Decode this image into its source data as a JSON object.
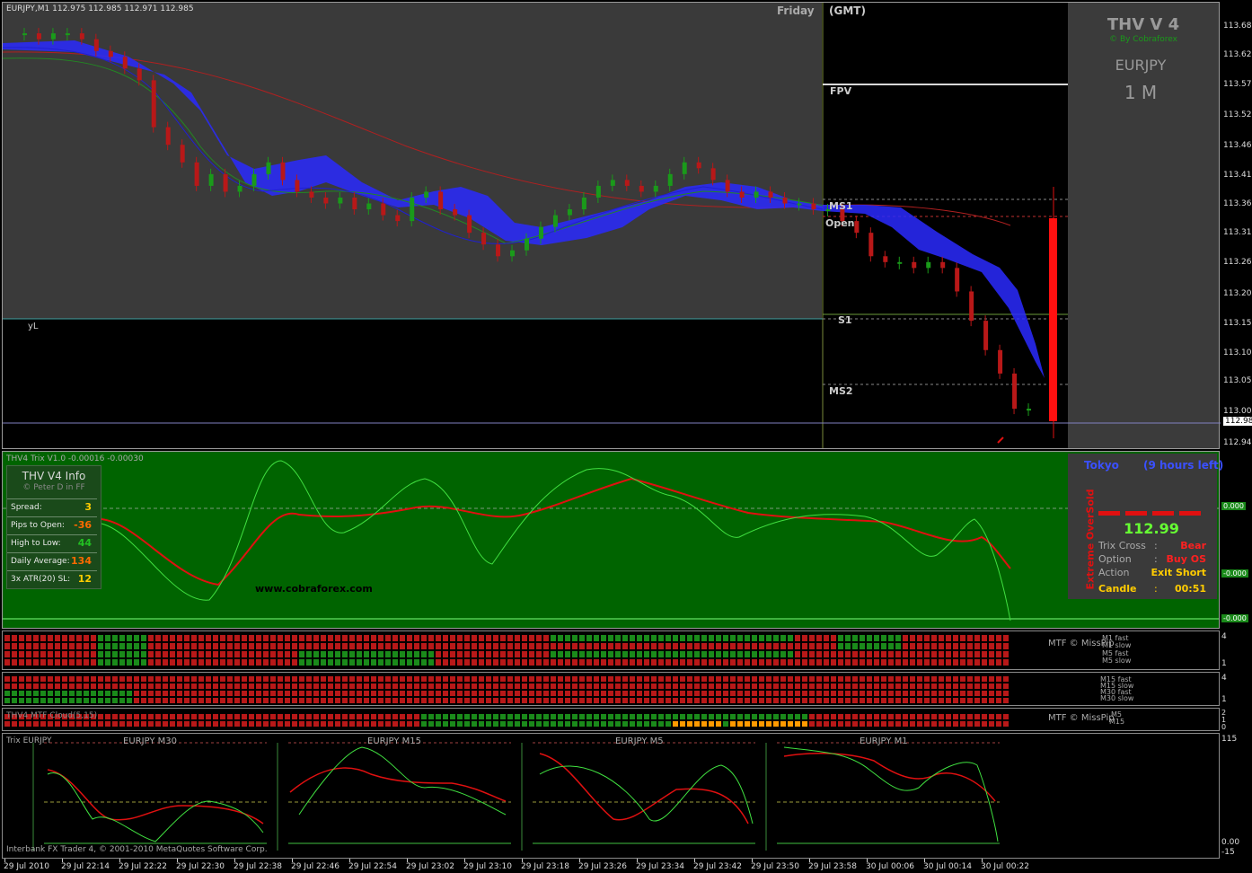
{
  "header": {
    "symbol_line": "EURJPY,M1  112.975 112.985 112.971 112.985",
    "day": "Friday",
    "tz": "(GMT)"
  },
  "levels": {
    "fpv": "FPV",
    "ms1": "MS1",
    "open": "Open",
    "s1": "S1",
    "ms2": "MS2",
    "yl": "yL"
  },
  "brand": {
    "title": "THV V 4",
    "by": "© By Cobraforex",
    "pair": "EURJPY",
    "tf": "1 M"
  },
  "price_axis": [
    "113.680",
    "113.625",
    "113.575",
    "113.520",
    "113.465",
    "113.415",
    "113.365",
    "113.310",
    "113.260",
    "113.205",
    "113.155",
    "113.105",
    "113.050",
    "113.000",
    "112.985",
    "112.945"
  ],
  "trix_axis": [
    "0.000",
    "-0.000",
    "-0.000"
  ],
  "trix_header": "THV4 Trix V1.0 -0.00016 -0.00030",
  "info_panel": {
    "title": "THV  V4  Info",
    "by": "© Peter D in FF",
    "rows": [
      {
        "k": "Spread:",
        "v": "3",
        "color": "#ffcc00"
      },
      {
        "k": "Pips to Open:",
        "v": "-36",
        "color": "#ff6a00"
      },
      {
        "k": "High to Low:",
        "v": "44",
        "color": "#22c022"
      },
      {
        "k": "Daily Average:",
        "v": "134",
        "color": "#ff6a00"
      },
      {
        "k": "3x ATR(20) SL:",
        "v": "12",
        "color": "#ffcc00"
      }
    ]
  },
  "watermark": "www.cobraforex.com",
  "signal_panel": {
    "session": "Tokyo",
    "left": "(9 hours left)",
    "vertical": "Extreme OverSold",
    "price": "112.99",
    "rows": [
      {
        "k": "Trix Cross",
        "sep": ":",
        "v": "Bear"
      },
      {
        "k": "Option",
        "sep": ":",
        "v": "Buy OS"
      },
      {
        "k": "Action",
        "sep": ":",
        "v": "Exit Short"
      },
      {
        "k": "Candle",
        "sep": ":",
        "v": "00:51"
      }
    ]
  },
  "mtf1": {
    "label": "MTF © MissPip",
    "lines": [
      "M1 fast",
      "M1 slow",
      "M5 fast",
      "M5 slow"
    ],
    "axis": [
      "4",
      "1"
    ]
  },
  "mtf2": {
    "lines": [
      "M15 fast",
      "M15 slow",
      "M30 fast",
      "M30 slow"
    ],
    "axis": [
      "4",
      "1"
    ]
  },
  "mtf3": {
    "title": "THV4 MTF Cloud(5,15)",
    "label": "MTF © MissPip",
    "lines": [
      "M5",
      "M15"
    ],
    "axis": [
      "2",
      "1",
      "0"
    ]
  },
  "bottom": {
    "title": "Trix EURJPY",
    "charts": [
      "EURJPY  M30",
      "EURJPY  M15",
      "EURJPY  M5",
      "EURJPY  M1"
    ],
    "axis": [
      "115",
      "0.00",
      "-15"
    ],
    "copyright": "Interbank FX Trader 4, © 2001-2010 MetaQuotes Software Corp."
  },
  "time_axis": [
    "29 Jul 2010",
    "29 Jul 22:14",
    "29 Jul 22:22",
    "29 Jul 22:30",
    "29 Jul 22:38",
    "29 Jul 22:46",
    "29 Jul 22:54",
    "29 Jul 23:02",
    "29 Jul 23:10",
    "29 Jul 23:18",
    "29 Jul 23:26",
    "29 Jul 23:34",
    "29 Jul 23:42",
    "29 Jul 23:50",
    "29 Jul 23:58",
    "30 Jul 00:06",
    "30 Jul 00:14",
    "30 Jul 00:22"
  ],
  "chart_data": {
    "type": "candlestick",
    "symbol": "EURJPY",
    "timeframe": "M1",
    "ylim": [
      112.945,
      113.68
    ],
    "last_price": 112.985,
    "close_series": [
      113.64,
      113.64,
      113.63,
      113.64,
      113.64,
      113.63,
      113.61,
      113.6,
      113.58,
      113.56,
      113.48,
      113.45,
      113.42,
      113.38,
      113.4,
      113.37,
      113.38,
      113.4,
      113.42,
      113.39,
      113.37,
      113.36,
      113.35,
      113.36,
      113.34,
      113.35,
      113.33,
      113.32,
      113.36,
      113.37,
      113.34,
      113.33,
      113.3,
      113.28,
      113.26,
      113.27,
      113.29,
      113.31,
      113.33,
      113.34,
      113.36,
      113.38,
      113.39,
      113.38,
      113.37,
      113.38,
      113.4,
      113.42,
      113.41,
      113.39,
      113.37,
      113.36,
      113.37,
      113.36,
      113.35,
      113.35,
      113.34,
      113.34,
      113.32,
      113.3,
      113.26,
      113.25,
      113.25,
      113.24,
      113.25,
      113.24,
      113.2,
      113.15,
      113.1,
      113.06,
      113.0,
      113.0
    ]
  }
}
